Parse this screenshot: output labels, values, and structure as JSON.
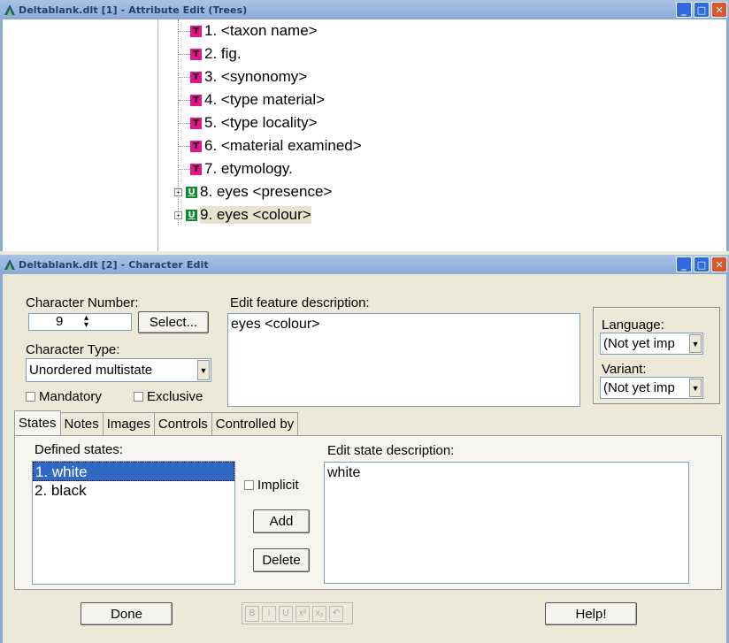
{
  "window1": {
    "title": "Deltablank.dlt [1] - Attribute Edit (Trees)",
    "items": [
      {
        "badge": "T",
        "label": "1. <taxon name>"
      },
      {
        "badge": "T",
        "label": "2. fig."
      },
      {
        "badge": "T",
        "label": "3. <synonomy>"
      },
      {
        "badge": "T",
        "label": "4. <type material>"
      },
      {
        "badge": "T",
        "label": "5. <type locality>"
      },
      {
        "badge": "T",
        "label": "6. <material examined>"
      },
      {
        "badge": "T",
        "label": "7. etymology."
      },
      {
        "badge": "U",
        "label": "8. eyes <presence>",
        "expander": "+"
      },
      {
        "badge": "U",
        "label": "9. eyes <colour>",
        "expander": "+"
      }
    ]
  },
  "window2": {
    "title": "Deltablank.dlt [2] - Character Edit",
    "character_number_label": "Character Number:",
    "character_number_value": "9",
    "select_button": "Select...",
    "character_type_label": "Character Type:",
    "character_type_value": "Unordered multistate",
    "mandatory_label": "Mandatory",
    "exclusive_label": "Exclusive",
    "edit_feature_label": "Edit feature description:",
    "feature_description": "eyes <colour>",
    "language_label": "Language:",
    "language_value": "(Not yet imp",
    "variant_label": "Variant:",
    "variant_value": "(Not yet imp",
    "tabs": [
      "States",
      "Notes",
      "Images",
      "Controls",
      "Controlled by"
    ],
    "defined_states_label": "Defined states:",
    "states": [
      "1. white",
      "2. black"
    ],
    "implicit_label": "Implicit",
    "add_button": "Add",
    "delete_button": "Delete",
    "edit_state_label": "Edit state description:",
    "state_description": "white",
    "done_button": "Done",
    "help_button": "Help!",
    "format_buttons": [
      "B",
      "I",
      "U",
      "x²",
      "x₂",
      "↶"
    ]
  },
  "colors": {
    "titlebar": "#8aaad6",
    "badge_t": "#e0158e",
    "badge_u": "#0a8a2a",
    "selection": "#316ac5",
    "window_bg": "#ece9d8"
  }
}
